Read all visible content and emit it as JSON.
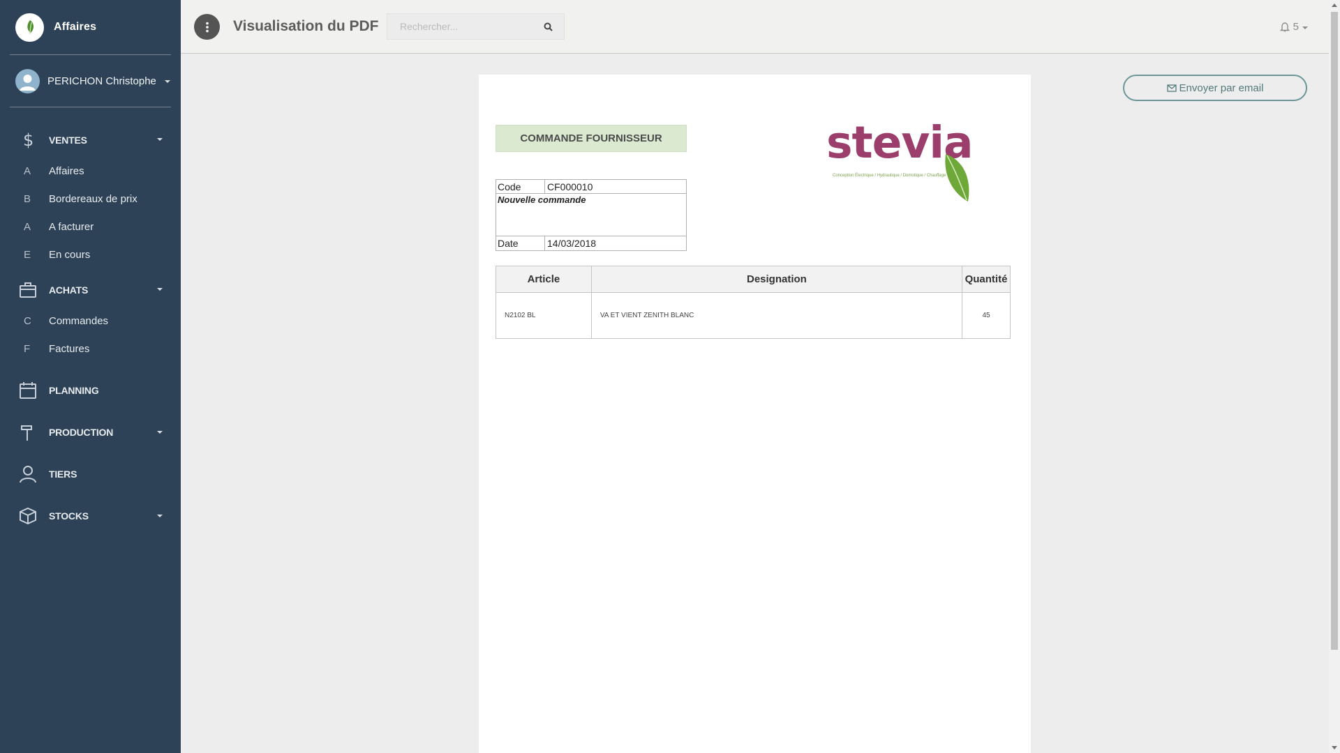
{
  "app": {
    "brand_name": "Affaires",
    "user_name": "PERICHON Christophe",
    "page_title": "Visualisation du PDF",
    "search_placeholder": "Rechercher...",
    "notification_count": "5"
  },
  "sidebar": {
    "sections": [
      {
        "label": "VENTES",
        "icon": "dollar-icon",
        "items": [
          {
            "letter": "A",
            "label": "Affaires"
          },
          {
            "letter": "B",
            "label": "Bordereaux de prix"
          },
          {
            "letter": "A",
            "label": "A facturer"
          },
          {
            "letter": "E",
            "label": "En cours"
          }
        ]
      },
      {
        "label": "ACHATS",
        "icon": "briefcase-icon",
        "items": [
          {
            "letter": "C",
            "label": "Commandes"
          },
          {
            "letter": "F",
            "label": "Factures"
          }
        ]
      },
      {
        "label": "PLANNING",
        "icon": "calendar-icon"
      },
      {
        "label": "PRODUCTION",
        "icon": "hammer-icon"
      },
      {
        "label": "TIERS",
        "icon": "user-icon"
      },
      {
        "label": "STOCKS",
        "icon": "box-icon"
      }
    ]
  },
  "actions": {
    "email_button": "Envoyer par email"
  },
  "document": {
    "title": "COMMANDE FOURNISSEUR",
    "logo_word": "stevia",
    "logo_tagline": "Conception Électrique / Hydraulique / Domotique / Chauffage",
    "code_label": "Code",
    "code_value": "CF000010",
    "note": "Nouvelle commande",
    "date_label": "Date",
    "date_value": "14/03/2018",
    "table": {
      "headers": [
        "Article",
        "Designation",
        "Quantité"
      ],
      "rows": [
        [
          "N2102 BL",
          "VA ET VIENT ZENITH BLANC",
          "45"
        ]
      ]
    }
  },
  "colors": {
    "sidebar_bg": "#2d4257",
    "title_band": "#dbe9d1",
    "logo_purple": "#9b3e6b",
    "logo_green": "#7aa14b",
    "email_button_border": "#6b9597"
  }
}
